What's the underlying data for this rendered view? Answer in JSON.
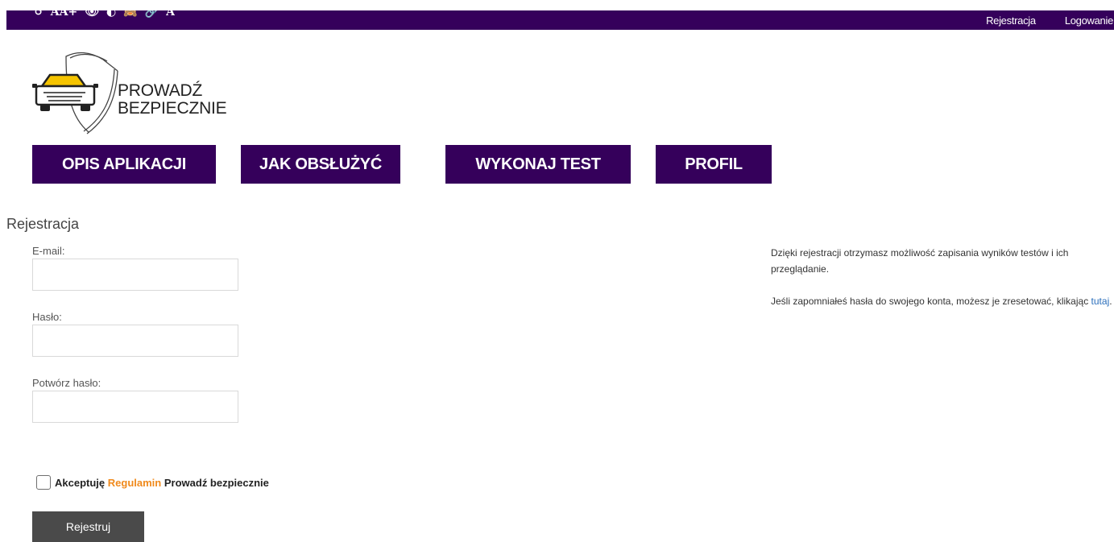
{
  "accessibility_toolbar": {
    "undo": "↺",
    "font_size": "AA+",
    "visibility": "👁",
    "contrast": "◐",
    "hide": "🙈",
    "links": "🔗",
    "font": "A"
  },
  "header": {
    "register_link": "Rejestracja",
    "login_link": "Logowanie",
    "background_color": "#35005b"
  },
  "logo": {
    "line1": "PROWADŹ",
    "line2": "BEZPIECZNIE",
    "car_color": "#f5c400"
  },
  "nav": {
    "items": [
      {
        "label": "OPIS APLIKACJI"
      },
      {
        "label": "JAK OBSŁUŻYĆ"
      },
      {
        "label": "WYKONAJ TEST"
      },
      {
        "label": "PROFIL"
      }
    ]
  },
  "form": {
    "title": "Rejestracja",
    "email_label": "E-mail:",
    "email_value": "",
    "password_label": "Hasło:",
    "password_value": "",
    "confirm_label": "Potwórz hasło:",
    "confirm_value": "",
    "accept_prefix": "Akceptuję",
    "accept_terms_link": "Regulamin",
    "accept_suffix": "Prowadź bezpiecznie",
    "accept_checked": false,
    "submit_label": "Rejestruj"
  },
  "info": {
    "benefit_text": "Dzięki rejestracji otrzymasz możliwość zapisania wyników testów i ich przeglądanie.",
    "reset_prefix": "Jeśli zapomniałeś hasła do swojego konta, możesz je zresetować, klikając",
    "reset_link": "tutaj",
    "reset_suffix": "."
  },
  "colors": {
    "brand_purple": "#35005b",
    "terms_orange": "#f08a1c",
    "link_blue": "#2a6ebb",
    "button_gray": "#4a4a4a"
  }
}
